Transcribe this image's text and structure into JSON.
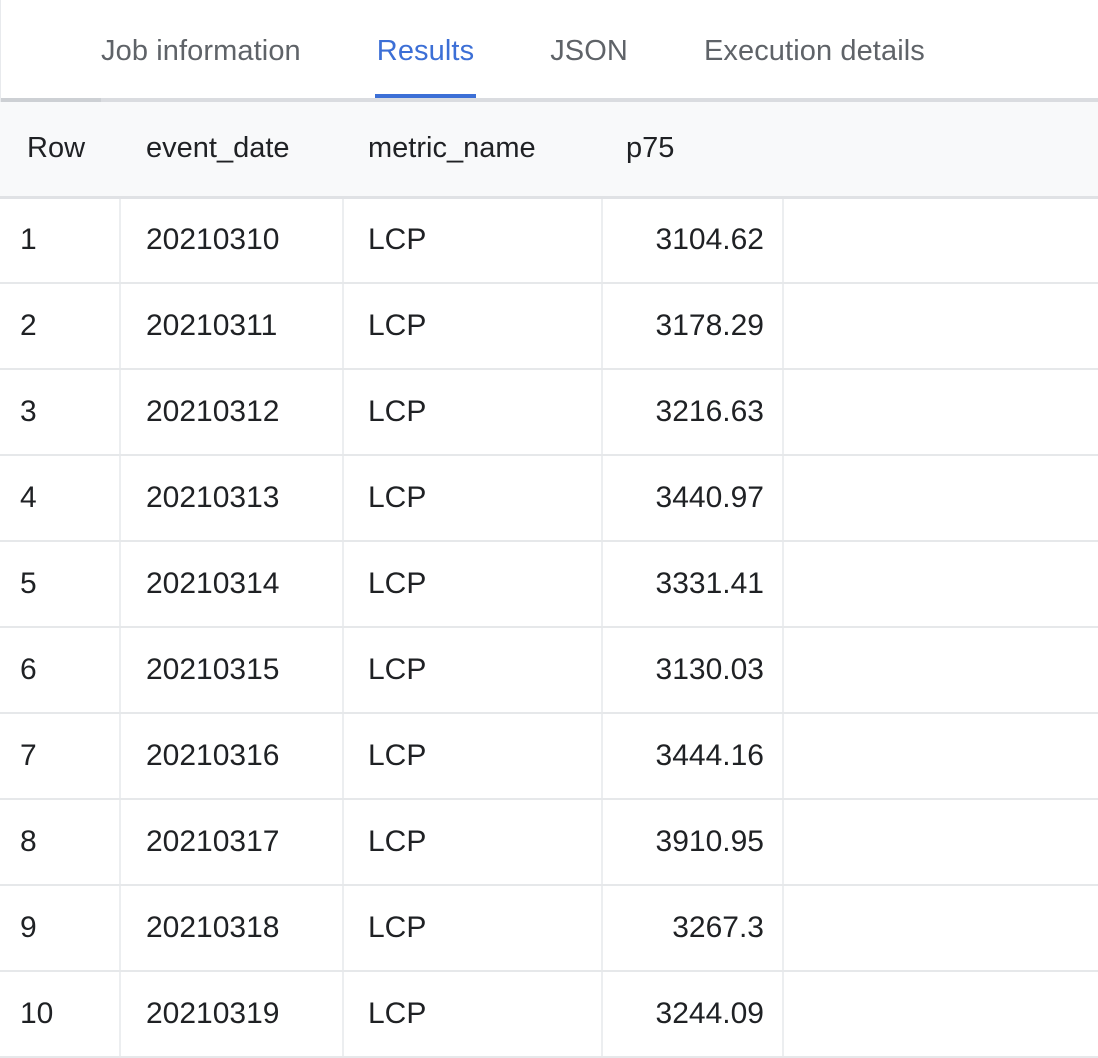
{
  "tabs": [
    {
      "label": "Job information",
      "active": false,
      "name": "tab-job-information"
    },
    {
      "label": "Results",
      "active": true,
      "name": "tab-results"
    },
    {
      "label": "JSON",
      "active": false,
      "name": "tab-json"
    },
    {
      "label": "Execution details",
      "active": false,
      "name": "tab-execution-details"
    }
  ],
  "colors": {
    "active_tab": "#3c6fd6",
    "inactive_tab": "#5f6368",
    "header_bg": "#f8f9fa",
    "header_text": "#1f2124",
    "cell_text": "#1f2124",
    "grid_line": "#e6e8ea"
  },
  "table": {
    "columns": [
      "Row",
      "event_date",
      "metric_name",
      "p75"
    ],
    "rows": [
      {
        "row": "1",
        "event_date": "20210310",
        "metric_name": "LCP",
        "p75": "3104.62"
      },
      {
        "row": "2",
        "event_date": "20210311",
        "metric_name": "LCP",
        "p75": "3178.29"
      },
      {
        "row": "3",
        "event_date": "20210312",
        "metric_name": "LCP",
        "p75": "3216.63"
      },
      {
        "row": "4",
        "event_date": "20210313",
        "metric_name": "LCP",
        "p75": "3440.97"
      },
      {
        "row": "5",
        "event_date": "20210314",
        "metric_name": "LCP",
        "p75": "3331.41"
      },
      {
        "row": "6",
        "event_date": "20210315",
        "metric_name": "LCP",
        "p75": "3130.03"
      },
      {
        "row": "7",
        "event_date": "20210316",
        "metric_name": "LCP",
        "p75": "3444.16"
      },
      {
        "row": "8",
        "event_date": "20210317",
        "metric_name": "LCP",
        "p75": "3910.95"
      },
      {
        "row": "9",
        "event_date": "20210318",
        "metric_name": "LCP",
        "p75": "3267.3"
      },
      {
        "row": "10",
        "event_date": "20210319",
        "metric_name": "LCP",
        "p75": "3244.09"
      }
    ]
  }
}
